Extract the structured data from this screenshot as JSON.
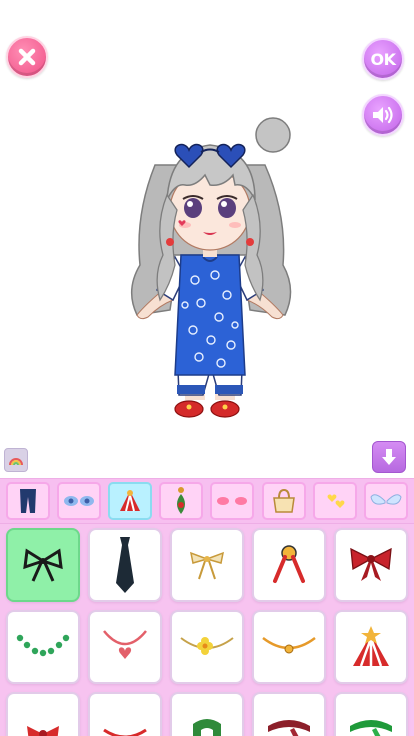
{
  "buttons": {
    "ok_label": "OK"
  },
  "icons": {
    "close": "close-icon",
    "ok": "ok-icon",
    "sound": "speaker-icon",
    "rainbow": "rainbow-icon",
    "down_arrow": "arrow-down-icon"
  },
  "colors": {
    "category_bar": "#f7bff0",
    "items_panel": "#f7c3f0",
    "selected_item": "#8ff0a8",
    "active_category": "#b9f1ff",
    "accent_purple": "#c060e8",
    "accent_pink": "#f04f86"
  },
  "categories": [
    {
      "name": "pants",
      "icon": "pants-icon",
      "active": false
    },
    {
      "name": "eyes",
      "icon": "eyes-icon",
      "active": false
    },
    {
      "name": "accessories",
      "icon": "scarf-icon",
      "active": true
    },
    {
      "name": "earrings",
      "icon": "earring-icon",
      "active": false
    },
    {
      "name": "blush",
      "icon": "blush-icon",
      "active": false
    },
    {
      "name": "bags",
      "icon": "handbag-icon",
      "active": false
    },
    {
      "name": "stickers",
      "icon": "hearts-icon",
      "active": false
    },
    {
      "name": "wings",
      "icon": "wings-icon",
      "active": false
    }
  ],
  "items": [
    {
      "name": "black-bow",
      "selected": true
    },
    {
      "name": "black-tie",
      "selected": false
    },
    {
      "name": "gold-bow-pin",
      "selected": false
    },
    {
      "name": "red-medal-ribbon",
      "selected": false
    },
    {
      "name": "red-bow",
      "selected": false
    },
    {
      "name": "green-bead-necklace",
      "selected": false
    },
    {
      "name": "heart-necklace",
      "selected": false
    },
    {
      "name": "flower-necklace",
      "selected": false
    },
    {
      "name": "gold-pendant-necklace",
      "selected": false
    },
    {
      "name": "striped-scarf-collar",
      "selected": false
    },
    {
      "name": "red-bow-partial",
      "selected": false
    },
    {
      "name": "red-necklace-partial",
      "selected": false
    },
    {
      "name": "green-scarf",
      "selected": false
    },
    {
      "name": "maroon-scarf",
      "selected": false
    },
    {
      "name": "green-scarf-2",
      "selected": false
    }
  ]
}
